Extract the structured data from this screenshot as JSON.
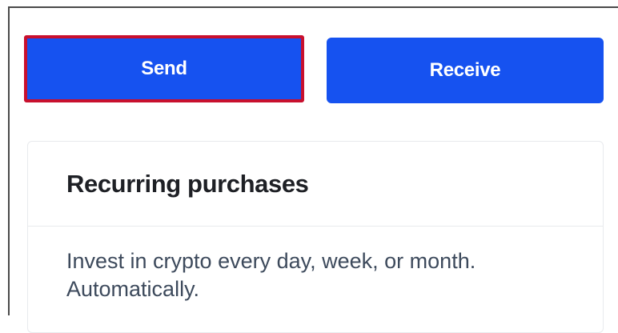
{
  "actions": {
    "send_label": "Send",
    "receive_label": "Receive"
  },
  "recurring": {
    "title": "Recurring purchases",
    "description": "Invest in crypto every day, week, or month. Automatically."
  },
  "colors": {
    "primary_button": "#1652f0",
    "highlight_border": "#c8102e",
    "card_border": "#e8eaed",
    "title_text": "#1e2025",
    "body_text": "#3d4a5c"
  }
}
